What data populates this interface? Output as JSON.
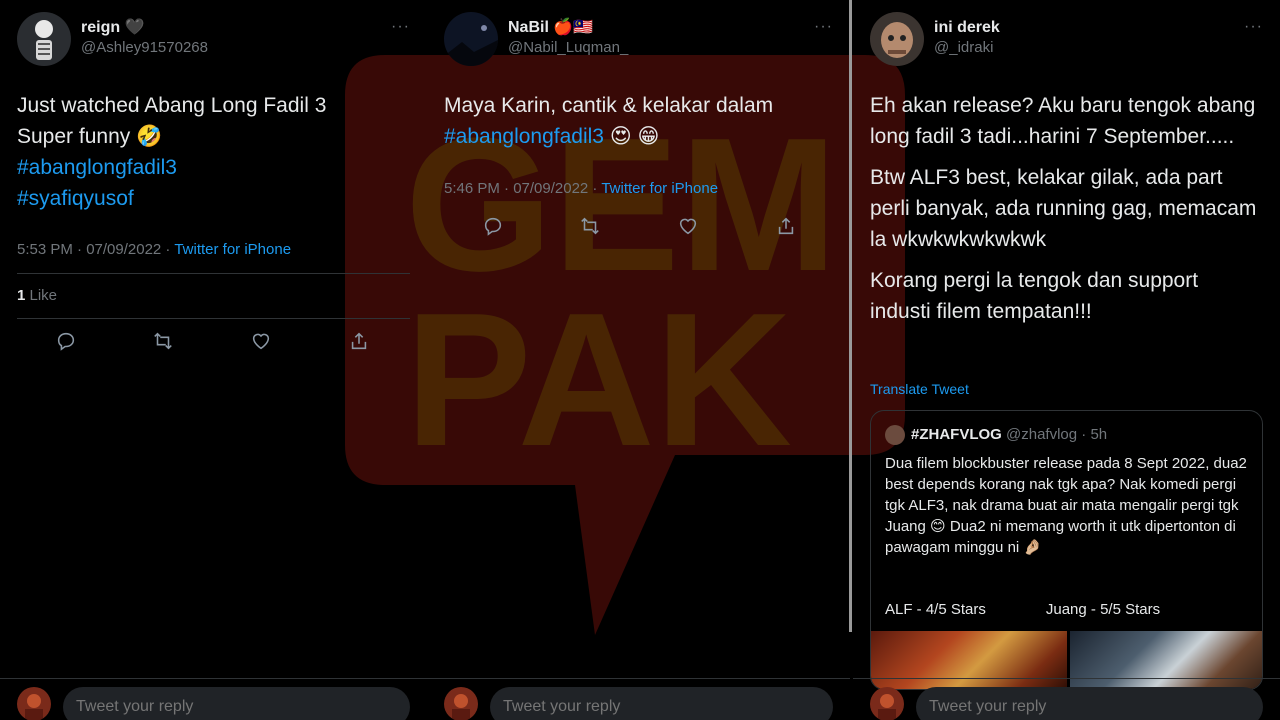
{
  "tweets": [
    {
      "display_name": "reign 🖤",
      "handle": "@Ashley91570268",
      "more": "···",
      "text_line1": "Just watched Abang Long Fadil 3",
      "text_line2": "Super funny 🤣",
      "hashtag1": "#abanglongfadil3",
      "hashtag2": "#syafiqyusof",
      "time": "5:53 PM · 07/09/2022 · ",
      "source": "Twitter for iPhone",
      "likes_count": "1",
      "likes_label": " Like"
    },
    {
      "display_name": "NaBil 🍎🇲🇾",
      "handle": "@Nabil_Luqman_",
      "more": "···",
      "text_line1": "Maya Karin, cantik & kelakar dalam",
      "hashtag1": "#abanglongfadil3",
      "emoji": " 😍 😁",
      "time": "5:46 PM · 07/09/2022 · ",
      "source": "Twitter for iPhone"
    },
    {
      "display_name": "ini derek",
      "handle": "@_idraki",
      "more": "···",
      "para1": "Eh akan release? Aku baru tengok abang long fadil 3 tadi...harini 7 September.....",
      "para2": "Btw ALF3 best, kelakar gilak, ada part perli banyak, ada running gag, memacam la wkwkwkwkwkwk",
      "para3": "Korang pergi la tengok dan support industi filem tempatan!!!",
      "translate": "Translate Tweet",
      "quote": {
        "name": "#ZHAFVLOG",
        "handle": "@zhafvlog · 5h",
        "text": "Dua filem blockbuster release pada 8 Sept 2022, dua2 best depends korang nak tgk apa? Nak komedi pergi tgk ALF3, nak drama buat air mata mengalir pergi tgk Juang 😊 Dua2 ni memang worth it utk dipertonton di pawagam minggu ni 🤌🏼",
        "rating1": "ALF - 4/5 Stars",
        "rating2": "Juang - 5/5 Stars"
      }
    }
  ],
  "reply": {
    "placeholder": "Tweet your reply"
  },
  "watermark": {
    "text1": "GEM",
    "text2": "PAK"
  },
  "colors": {
    "accent": "#1d9bf0",
    "muted": "#71767b",
    "text": "#e7e9ea",
    "background": "#000000",
    "watermark": "#ff2a1a"
  }
}
